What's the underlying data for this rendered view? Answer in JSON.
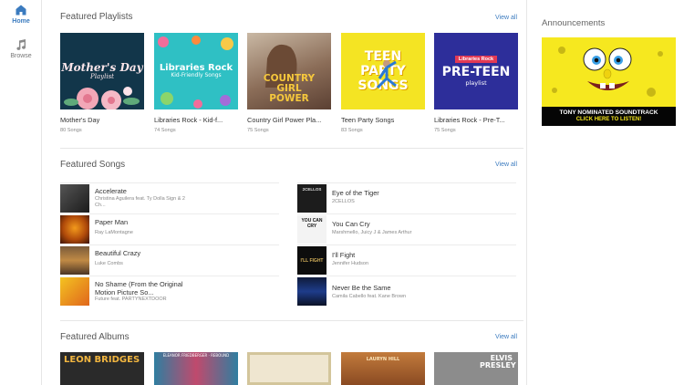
{
  "nav": {
    "items": [
      {
        "label": "Home",
        "icon": "home-icon"
      },
      {
        "label": "Browse",
        "icon": "music-note-icon"
      }
    ]
  },
  "featured_playlists": {
    "title": "Featured Playlists",
    "view_all": "View all",
    "items": [
      {
        "title": "Mother's Day",
        "count": "80 Songs",
        "cover_text": "Mother's Day",
        "cover_sub": "Playlist"
      },
      {
        "title": "Libraries Rock - Kid-f...",
        "count": "74 Songs",
        "cover_text": "Libraries Rock",
        "cover_sub": "Kid-Friendly Songs"
      },
      {
        "title": "Country Girl Power Pla...",
        "count": "75 Songs",
        "cover_text": "COUNTRY GIRL POWER"
      },
      {
        "title": "Teen Party Songs",
        "count": "83 Songs",
        "cover_text": "TEEN PARTY SONGS"
      },
      {
        "title": "Libraries Rock - Pre-T...",
        "count": "75 Songs",
        "cover_tag": "Libraries Rock",
        "cover_text": "PRE-TEEN",
        "cover_sub": "playlist"
      }
    ]
  },
  "featured_songs": {
    "title": "Featured Songs",
    "view_all": "View all",
    "left": [
      {
        "title": "Accelerate",
        "artist": "Christina Aguilera feat. Ty Dolla Sign & 2 Ch..."
      },
      {
        "title": "Paper Man",
        "artist": "Ray LaMontagne"
      },
      {
        "title": "Beautiful Crazy",
        "artist": "Luke Combs"
      },
      {
        "title": "No Shame (From the Original Motion Picture So...",
        "artist": "Future feat. PARTYNEXTDOOR"
      }
    ],
    "right": [
      {
        "title": "Eye of the Tiger",
        "artist": "2CELLOS",
        "thumb_text": "2CELLOS"
      },
      {
        "title": "You Can Cry",
        "artist": "Marshmello, Juicy J & James Arthur",
        "thumb_text": "YOU CAN CRY"
      },
      {
        "title": "I'll Fight",
        "artist": "Jennifer Hudson",
        "thumb_text": "I'LL FIGHT"
      },
      {
        "title": "Never Be the Same",
        "artist": "Camila Cabello feat. Kane Brown"
      }
    ]
  },
  "featured_albums": {
    "title": "Featured Albums",
    "view_all": "View all",
    "covers": [
      {
        "text": "LEON BRIDGES"
      },
      {
        "text": "ELEANOR FRIEDBERGER · REBOUND"
      },
      {
        "text": ""
      },
      {
        "text": "LAURYN HILL"
      },
      {
        "text": "ELVIS PRESLEY"
      }
    ]
  },
  "announcements": {
    "title": "Announcements",
    "ad_line1": "TONY NOMINATED SOUNDTRACK",
    "ad_line2": "CLICK HERE TO LISTEN!"
  },
  "colors": {
    "accent": "#3b7bbf",
    "ad_yellow": "#f6e81f"
  }
}
